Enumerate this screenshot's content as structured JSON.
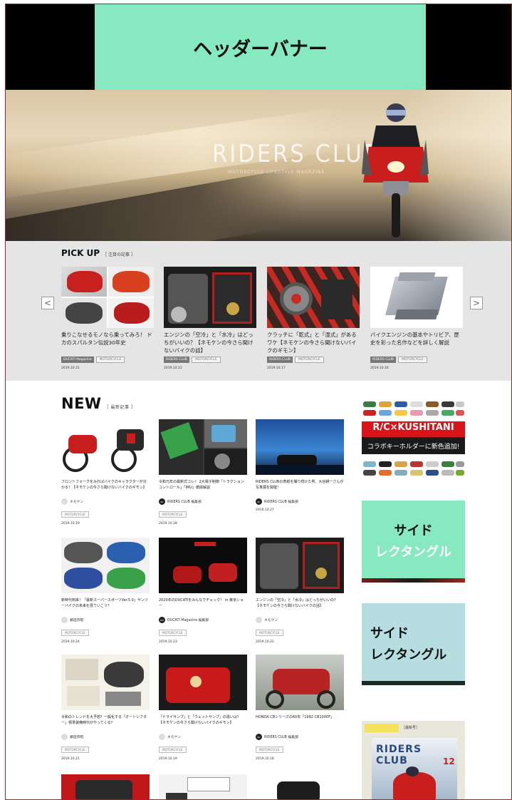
{
  "header": {
    "banner_label": "ヘッダーバナー"
  },
  "hero": {
    "title": "RIDERS CLUB",
    "subtitle": "MOTORCYCLE LIFESTYLE MAGAZINE"
  },
  "pickup": {
    "title": "PICK UP",
    "subtitle": "［ 注目の記事 ］",
    "prev": "<",
    "next": ">",
    "cards": [
      {
        "text": "乗りこなせるモノなら乗ってみろ！ ドカのスパルタン伝説30年史",
        "tag1": "DUCATI Magazine",
        "tag2": "MOTORCYCLE",
        "date": "2019.10.31"
      },
      {
        "text": "エンジンの「空冷」と「水冷」はどっちがいいの？【ネモケンの今さら聞けないバイクの話】",
        "tag1": "RIDERS CLUB",
        "tag2": "MOTORCYCLE",
        "date": "2019.10.22"
      },
      {
        "text": "クラッチに「乾式」と「湿式」があるワケ【ネモケンの今さら聞けないバイクのギモン】",
        "tag1": "RIDERS CLUB",
        "tag2": "MOTORCYCLE",
        "date": "2019.10.17"
      },
      {
        "text": "バイクエンジンの基本やトリビア、歴史を彩った名作などを詳しく解説",
        "tag1": "RIDERS CLUB",
        "tag2": "MOTORCYCLE",
        "date": "2019.10.16"
      }
    ]
  },
  "new": {
    "title": "NEW",
    "subtitle": "［ 最新記事 ］",
    "cards": [
      {
        "text": "フロントフォークをみればバイクのキャラクターが分かる！【ネモケンの今さら聞けないバイクのギモン】",
        "author": "ネモケン",
        "avatar": "",
        "tag": "MOTORCYCLE",
        "date": "2019.10.29"
      },
      {
        "text": "令和元年の最新式コレ！ 2大電子制御「トラクションコントロール」「IMU」徹底解説",
        "author": "RIDERS CLUB 編集部",
        "avatar": "RC",
        "tag": "MOTORCYCLE",
        "date": "2019.10.28"
      },
      {
        "text": "RIDERS CLUBの表紙を撮り続けた男、大谷耕一さんが写真展を開催！",
        "author": "RIDERS CLUB 編集部",
        "avatar": "RC",
        "tag": "",
        "date": "2019.10.27"
      },
      {
        "text": "新時代到来！「最新スーパースポーツVer.5.0」サンツーバイクの未来を見ていこう？",
        "author": "藤田宗昭",
        "avatar": "",
        "tag": "MOTORCYCLE",
        "date": "2019.10.24"
      },
      {
        "text": "2020年のDUCATIをみんなでチェック！ in 東京ショー",
        "author": "DUCATI Magazine 編集部",
        "avatar": "DM",
        "tag": "MOTORCYCLE",
        "date": "2019.10.23"
      },
      {
        "text": "エンジンの「空冷」と「水冷」はどっちがいいの？【ネモケンの今さら聞けないバイクの話】",
        "author": "ネモケン",
        "avatar": "",
        "tag": "MOTORCYCLE",
        "date": "2019.10.22"
      },
      {
        "text": "令和のトレンドを大予想？一般化する「オートシフター」標準装備時代がやってくる？",
        "author": "藤田宗昭",
        "avatar": "",
        "tag": "MOTORCYCLE",
        "date": "2019.10.21"
      },
      {
        "text": "「ドライサンプ」と「ウェットサンプ」の違いは？【ネモケンの今さら聞けないバイクのギモン】",
        "author": "ネモケン",
        "avatar": "",
        "tag": "MOTORCYCLE",
        "date": "2019.10.19"
      },
      {
        "text": "HONDA CBシリーズの60年「1992 CB1000F」",
        "author": "RIDERS CLUB 編集部",
        "avatar": "RC",
        "tag": "MOTORCYCLE",
        "date": "2019.10.18"
      }
    ]
  },
  "sidebar": {
    "kushitani_title": "R/C×KUSHITANI",
    "kushitani_sub": "コラボキーホルダーに新色追加!",
    "rect1_line1": "サイド",
    "rect1_line2": "レクタングル",
    "rect2_line1": "サイド",
    "rect2_line2": "レクタングル",
    "magazine_label": "［最新号］",
    "magazine_title": "RIDERS CLUB",
    "magazine_issue": "12"
  }
}
